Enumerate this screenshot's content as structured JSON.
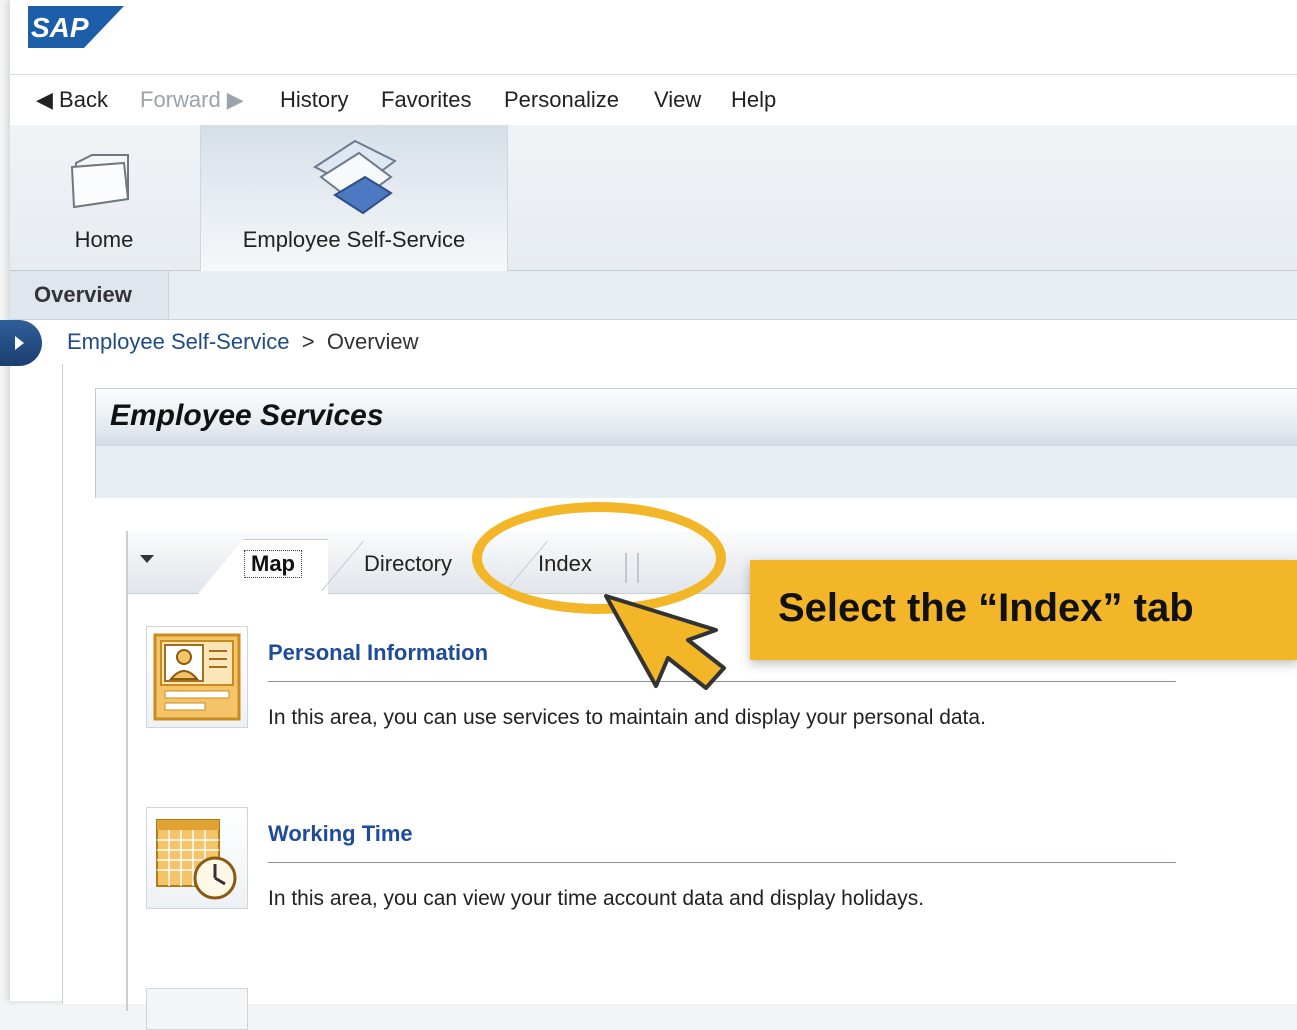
{
  "logo": {
    "text": "SAP"
  },
  "menu": {
    "back": "Back",
    "forward": "Forward",
    "history": "History",
    "favorites": "Favorites",
    "personalize": "Personalize",
    "view": "View",
    "help": "Help"
  },
  "nav": {
    "home": "Home",
    "ess": "Employee Self-Service"
  },
  "subnav": {
    "overview": "Overview"
  },
  "breadcrumb": {
    "root": "Employee Self-Service",
    "sep": ">",
    "current": "Overview"
  },
  "panel": {
    "title": "Employee Services"
  },
  "tabs": {
    "map": "Map",
    "directory": "Directory",
    "index": "Index"
  },
  "items": [
    {
      "title": "Personal Information",
      "desc": "In this area, you can use services to maintain and display your personal data."
    },
    {
      "title": "Working Time",
      "desc": "In this area, you can view your time account data and display holidays."
    }
  ],
  "annotation": {
    "callout": "Select the “Index” tab",
    "accent_color": "#f2b628"
  }
}
